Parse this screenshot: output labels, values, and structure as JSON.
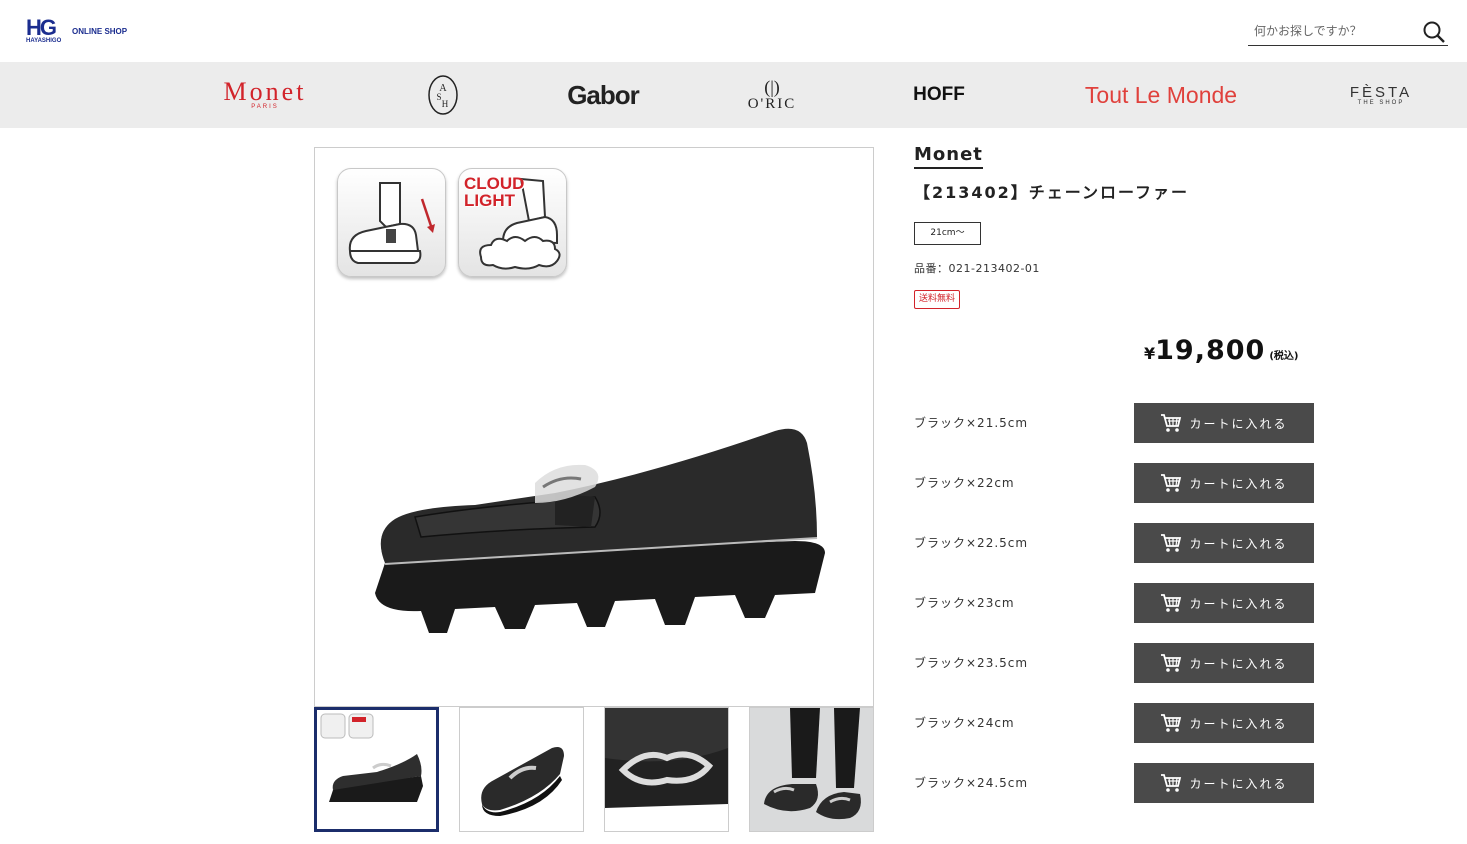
{
  "header": {
    "logo_mark": "HG",
    "logo_sub": "HAYASHIGO",
    "logo_shop": "ONLINE SHOP",
    "search_placeholder": "何かお探しですか？"
  },
  "brands": {
    "monet": "Monet",
    "monet_sub": "PARIS",
    "ash": "ASH",
    "gabor": "Gabor",
    "oric_mark": "(|)",
    "oric": "O'RIC",
    "hoff": "HOFF",
    "tout": "Tout Le Monde",
    "festa": "FÈSTA",
    "festa_sub": "THE SHOP"
  },
  "image_badges": {
    "cloud_line1": "CLOUD",
    "cloud_line2": "LIGHT"
  },
  "product": {
    "brand": "Monet",
    "title": "【213402】チェーンローファー",
    "size_tag": "21cm～",
    "code": "品番：021-213402-01",
    "free_shipping": "送料無料",
    "price_symbol": "¥",
    "price": "19,800",
    "tax_note": "(税込)"
  },
  "variants": [
    {
      "label": "ブラック×21.5cm",
      "button": "カートに入れる"
    },
    {
      "label": "ブラック×22cm",
      "button": "カートに入れる"
    },
    {
      "label": "ブラック×22.5cm",
      "button": "カートに入れる"
    },
    {
      "label": "ブラック×23cm",
      "button": "カートに入れる"
    },
    {
      "label": "ブラック×23.5cm",
      "button": "カートに入れる"
    },
    {
      "label": "ブラック×24cm",
      "button": "カートに入れる"
    },
    {
      "label": "ブラック×24.5cm",
      "button": "カートに入れる"
    }
  ],
  "icons": {
    "search": "search-icon",
    "cart": "cart-icon"
  }
}
